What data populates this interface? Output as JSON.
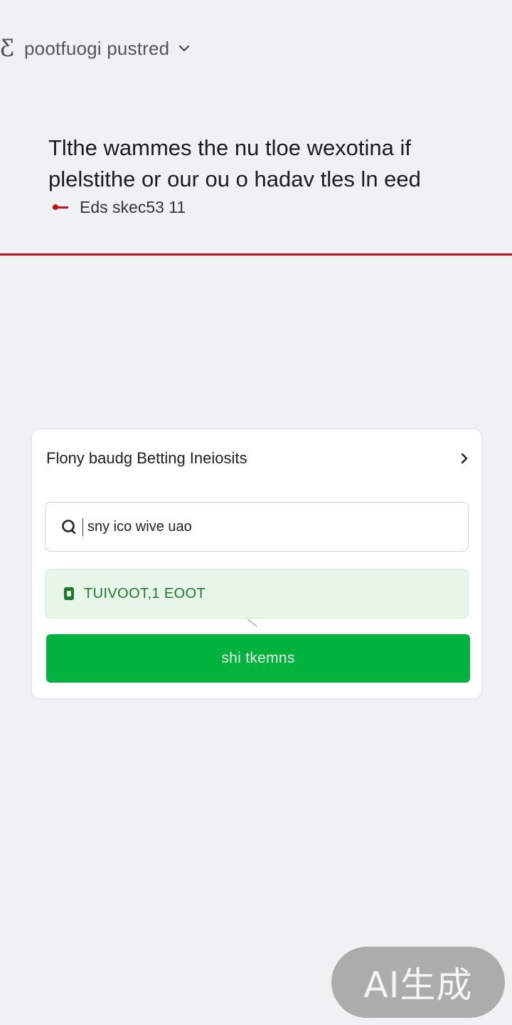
{
  "topbar": {
    "logo_glyph": "Ƹ",
    "title": "pootfuogi pustred",
    "chevron_icon": "chevron-down-icon"
  },
  "headline": {
    "text": "Tlthe wammes the nu tloe wexotina if plelstithe or our ou o hadav tles ln eed"
  },
  "meta": {
    "text": "Eds skec53 11",
    "accent_color": "#c1121f"
  },
  "card": {
    "title": "Flony baudg Betting Ineiosits",
    "chevron_icon": "chevron-right-icon",
    "search": {
      "icon": "search-icon",
      "value": "sny ico wive uao"
    },
    "status": {
      "icon": "status-icon",
      "text": "TUIVOOT,1 EOOT",
      "color": "#1d7a2c"
    },
    "button_label": "shi tkemns",
    "button_color": "#00b33c"
  },
  "watermark": {
    "text": "AI生成"
  }
}
